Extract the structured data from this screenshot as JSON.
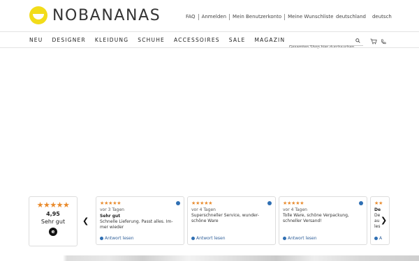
{
  "brand": {
    "name": "NOBANANAS"
  },
  "header": {
    "links": [
      "FAQ",
      "Anmelden",
      "Mein Benutzerkonto",
      "Meine Wunschliste"
    ],
    "country": "deutschland",
    "language": "deutsch"
  },
  "nav": {
    "items": [
      "NEU",
      "DESIGNER",
      "KLEIDUNG",
      "SCHUHE",
      "ACCESSOIRES",
      "SALE",
      "MAGAZIN"
    ]
  },
  "search": {
    "placeholder": "Gesamten Shop hier durchsuchen"
  },
  "reviews_summary": {
    "stars": "★★★★★",
    "score": "4,95",
    "label": "Sehr gut",
    "badge": "e"
  },
  "reviews": [
    {
      "stars": "★★★★★",
      "date": "vor 3 Tagen",
      "title": "Sehr gut",
      "text": "Schnelle Lieferung. Passt alles. Im- mer wieder",
      "reply": "Antwort lesen"
    },
    {
      "stars": "★★★★★",
      "date": "vor 4 Tagen",
      "title": "",
      "text": "Superschneller Service, wunder- schöne Ware",
      "reply": "Antwort lesen"
    },
    {
      "stars": "★★★★★",
      "date": "vor 4 Tagen",
      "title": "",
      "text": "Tolle Ware, schöne Verpackung, schneller Versand!",
      "reply": "Antwort lesen"
    },
    {
      "stars": "★★",
      "date": "",
      "title": "De",
      "text": "De au les",
      "reply": "A"
    }
  ],
  "icons": {
    "search": "search-icon",
    "cart": "cart-icon",
    "phone": "phone-icon",
    "prev": "chevron-left-icon",
    "next": "chevron-right-icon"
  },
  "colors": {
    "logo_yellow": "#f2dc1a",
    "star_orange": "#e98a2b",
    "link_blue": "#2f5f99"
  }
}
